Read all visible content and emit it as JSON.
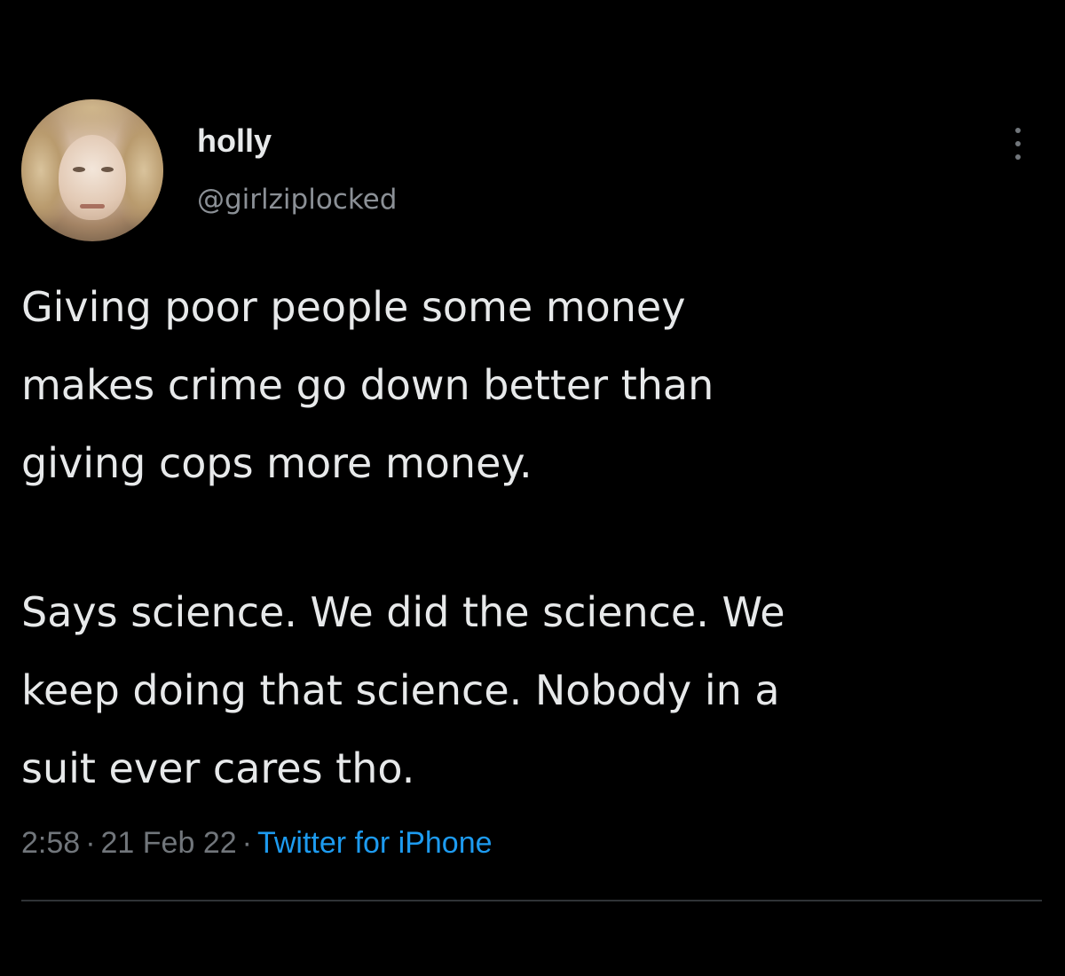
{
  "tweet": {
    "author": {
      "display_name": "holly",
      "handle": "@girlziplocked",
      "avatar_icon": "user-avatar-photo"
    },
    "more_icon": "more-vertical-icon",
    "text_paragraphs": [
      "Giving poor people some money\nmakes crime go down better than\ngiving cops more money.",
      "Says science. We did the science. We\nkeep doing that science. Nobody in a\nsuit ever cares tho."
    ],
    "meta": {
      "time": "2:58",
      "separator": "·",
      "date": "21 Feb 22",
      "source": "Twitter for iPhone"
    }
  },
  "colors": {
    "background": "#000000",
    "primary_text": "#e7e9ea",
    "secondary_text": "#71767b",
    "link": "#1d9bf0",
    "divider": "#2f3336"
  }
}
